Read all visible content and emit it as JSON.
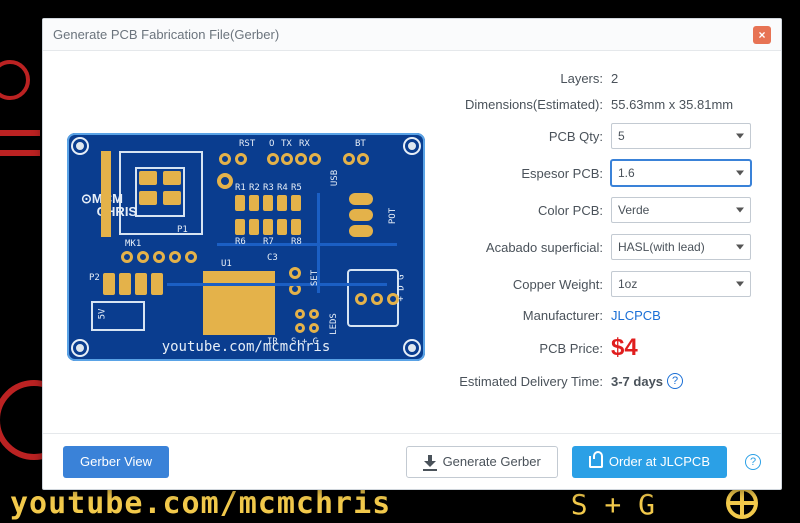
{
  "background": {
    "watermark": "youtube.com/mcmchris",
    "sg_label": "S  +  G"
  },
  "modal": {
    "title": "Generate PCB Fabrication File(Gerber)",
    "close": "×"
  },
  "board": {
    "url": "youtube.com/mcmchris",
    "logo_line1": "MCM",
    "logo_line2": "CHRIS",
    "labels": {
      "rst": "RST",
      "bt": "BT",
      "usb": "USB",
      "pot": "POT",
      "mk1": "MK1",
      "p1": "P1",
      "p2": "P2",
      "fiveV": "5V",
      "u1": "U1",
      "c3": "C3",
      "set": "SET",
      "leds": "LEDS",
      "ir": "IR",
      "sg": "S  +  G",
      "dg": "+ D G",
      "r1": "R1",
      "r2": "R2",
      "r3": "R3",
      "r4": "R4",
      "r5": "R5",
      "r6": "R6",
      "r7": "R7",
      "r8": "R8",
      "tx": "TX",
      "rx": "RX",
      "o": "O"
    }
  },
  "props": {
    "layers": {
      "label": "Layers:",
      "value": "2"
    },
    "dims": {
      "label": "Dimensions(Estimated):",
      "value": "55.63mm x 35.81mm"
    },
    "qty": {
      "label": "PCB Qty:",
      "value": "5"
    },
    "thickness": {
      "label": "Espesor PCB:",
      "value": "1.6"
    },
    "color": {
      "label": "Color PCB:",
      "value": "Verde"
    },
    "finish": {
      "label": "Acabado superficial:",
      "value": "HASL(with lead)"
    },
    "copper": {
      "label": "Copper Weight:",
      "value": "1oz"
    },
    "mfr": {
      "label": "Manufacturer:",
      "value": "JLCPCB"
    },
    "price": {
      "label": "PCB Price:",
      "value": "$4"
    },
    "eta": {
      "label": "Estimated Delivery Time:",
      "value": "3-7 days"
    }
  },
  "footer": {
    "gerber_view": "Gerber View",
    "generate": "Generate Gerber",
    "order": "Order at JLCPCB",
    "help": "?"
  }
}
